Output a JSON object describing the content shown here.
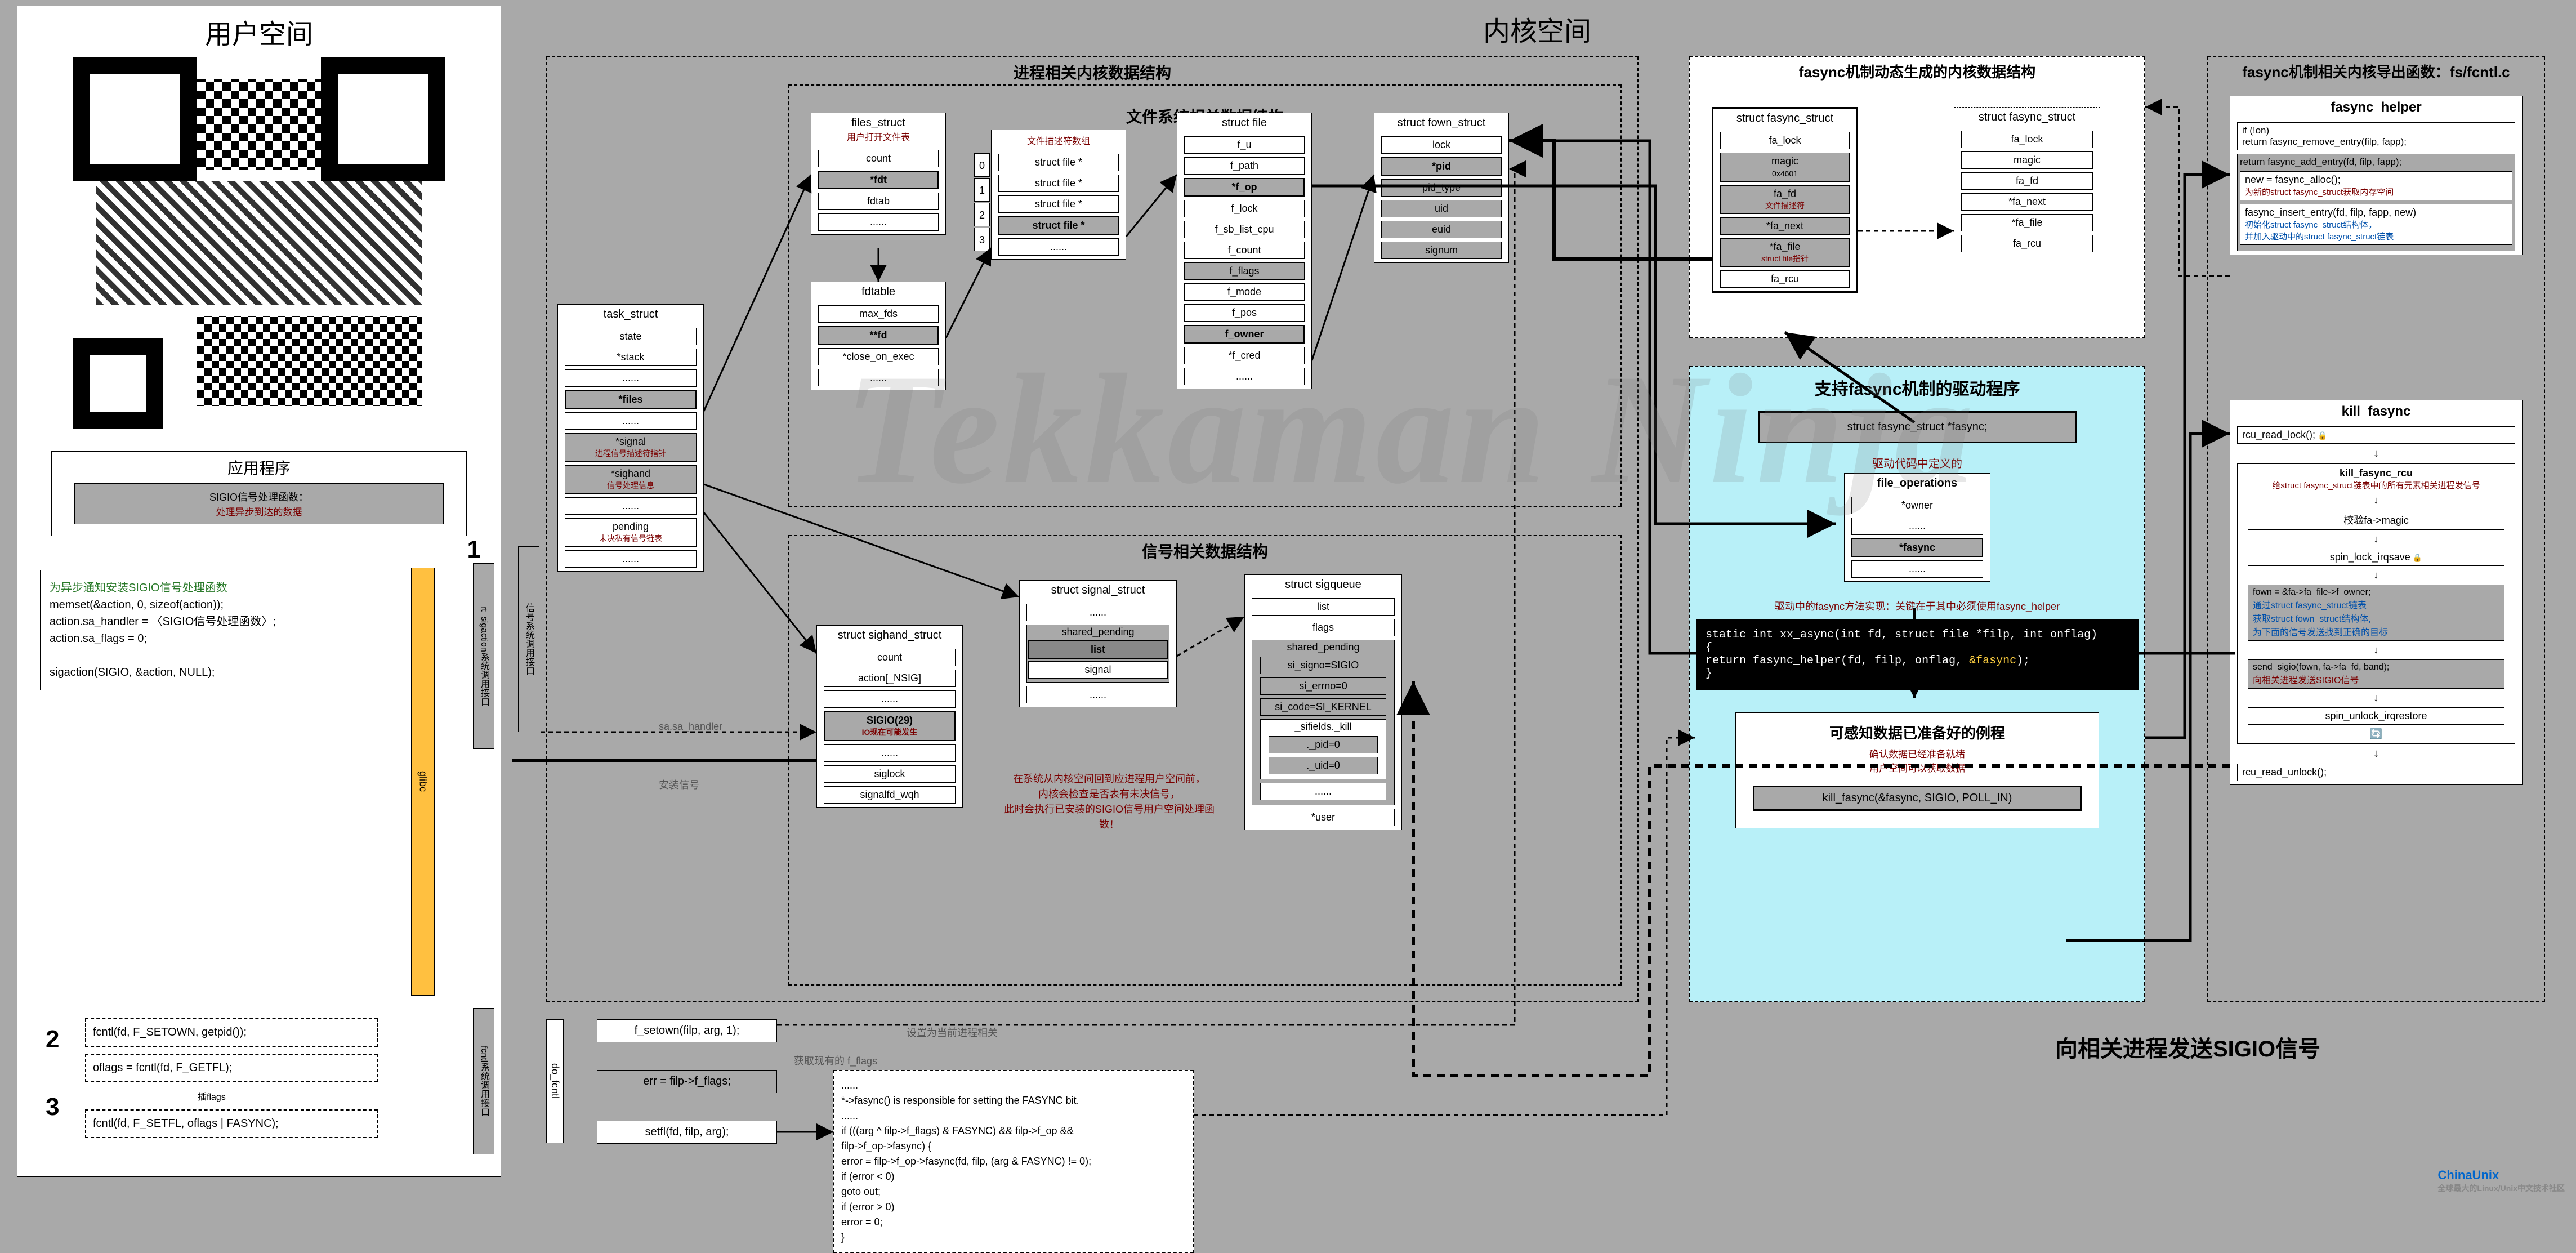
{
  "titles": {
    "user_space": "用户空间",
    "kernel_space": "内核空间",
    "app_box": "应用程序",
    "watermark": "Tekkaman Ninja"
  },
  "sigio_handler": {
    "line1": "SIGIO信号处理函数：",
    "line2": "处理异步到达的数据"
  },
  "user_code": {
    "c1": "为异步通知安装SIGIO信号处理函数",
    "l1": "memset(&action, 0, sizeof(action));",
    "l2": "action.sa_handler = 〈SIGIO信号处理函数〉;",
    "l3": "action.sa_flags = 0;",
    "l4": "sigaction(SIGIO, &action, NULL);"
  },
  "step2": {
    "code": "fcntl(fd, F_SETOWN, getpid());"
  },
  "step3": {
    "code1": "oflags = fcntl(fd, F_GETFL);",
    "inter": "插flags",
    "code2": "fcntl(fd, F_SETFL, oflags | FASYNC);"
  },
  "task_struct": {
    "title": "task_struct",
    "fields": [
      "state",
      "*stack",
      "......",
      "*files",
      "......",
      "*signal",
      "*sighand",
      "......",
      "pending",
      "......"
    ],
    "signal_sub": "进程信号描述符指针",
    "sighand_sub": "信号处理信息",
    "pending_sub": "未决私有信号链表"
  },
  "proc_group": {
    "title": "进程相关内核数据结构"
  },
  "file_group": {
    "title": "文件系统相关数据结构",
    "files_struct": "files_struct",
    "files_struct_sub": "用户打开文件表",
    "fs_fields": [
      "count",
      "*fdt",
      "fdtab",
      "......"
    ],
    "fdtable": "fdtable",
    "fdtable_sub": "文件描述符数组",
    "fdt_fields": [
      "max_fds",
      "**fd",
      "*close_on_exec",
      "......"
    ],
    "arr": [
      "struct file *",
      "struct file *",
      "struct file *",
      "struct file *",
      "......"
    ],
    "struct_file": "struct file",
    "file_fields": [
      "f_u",
      "f_path",
      "*f_op",
      "f_lock",
      "f_sb_list_cpu",
      "f_count",
      "f_flags",
      "f_mode",
      "f_pos",
      "f_owner",
      "*f_cred",
      "......"
    ],
    "fown_struct": "struct fown_struct",
    "fown_fields": [
      "lock",
      "*pid",
      "pid_type",
      "uid",
      "euid",
      "signum"
    ]
  },
  "signal_group": {
    "title": "信号相关数据结构",
    "sighand": "struct sighand_struct",
    "sighand_fields": [
      "count",
      "action[_NSIG]",
      "......",
      "siglock",
      "signalfd_wqh"
    ],
    "action_hl": "SIGIO(29)",
    "action_hl_sub": "IO现在可能发生",
    "signal_struct": "struct signal_struct",
    "ss_fields": [
      "......",
      "shared_pending",
      "......",
      "signal",
      "......"
    ],
    "ss_list": "list",
    "sigqueue": "struct sigqueue",
    "sq_fields": [
      "list",
      "flags",
      "shared_pending",
      "si_signo=SIGIO",
      "si_errno=0",
      "si_code=SI_KERNEL",
      "_sifields._kill",
      "._pid=0",
      "._uid=0",
      "......",
      "*user"
    ],
    "note1": "在系统从内核空间回到应进程用户空间前，",
    "note2": "内核会检查是否表有未决信号，",
    "note3": "此时会执行已安装的SIGIO信号用户空间处理函数！"
  },
  "fasync_group": {
    "title": "fasync机制动态生成的内核数据结构",
    "fasync_struct": "struct fasync_struct",
    "fa_fields": [
      "fa_lock",
      "magic",
      "fa_fd",
      "*fa_next",
      "*fa_file",
      "fa_rcu"
    ],
    "fa_magic": "0x4601",
    "fa_fd_sub": "文件描述符",
    "fa_file_sub": "struct file指针"
  },
  "driver_panel": {
    "title": "支持fasync机制的驱动程序",
    "ptr_decl": "struct fasync_struct *fasync;",
    "fops_sub": "驱动代码中定义的",
    "fops": "file_operations",
    "fops_fields": [
      "*owner",
      "......",
      "*fasync",
      "......"
    ],
    "method_note": "驱动中的fasync方法实现：关键在于其中必须使用fasync_helper",
    "code_l1": "static int xx_async(int fd, struct file *filp, int onflag)",
    "code_l2": "{",
    "code_l3": "    return fasync_helper(fd, filp, onflag, &fasync);",
    "code_l4": "}",
    "ready": "可感知数据已准备好的例程",
    "ready_sub1": "确认数据已经准备就绪",
    "ready_sub2": "用户空间可以获取数据",
    "kill_call": "kill_fasync(&fasync, SIGIO, POLL_IN)"
  },
  "export_group": {
    "title": "fasync机制相关内核导出函数：fs/fcntl.c",
    "fasync_helper": "fasync_helper",
    "fh_l1": "if (!on)",
    "fh_l2": "  return fasync_remove_entry(filp, fapp);",
    "fh_l3": "return fasync_add_entry(fd, filp, fapp);",
    "fh_alloc": "new = fasync_alloc();",
    "fh_alloc_sub": "为新的struct fasync_struct获取内存空间",
    "fh_insert": "fasync_insert_entry(fd, filp, fapp, new)",
    "fh_insert_sub1": "初始化struct fasync_struct结构体，",
    "fh_insert_sub2": "并加入驱动中的struct fasync_struct链表",
    "kill_fasync": "kill_fasync",
    "kf_l1": "rcu_read_lock();",
    "kf_rcu": "kill_fasync_rcu",
    "kf_rcu_sub": "给struct fasync_struct链表中的所有元素相关进程发信号",
    "kf_l2": "校验fa->magic",
    "kf_l3": "spin_lock_irqsave",
    "kf_l4a": "fown = &fa->fa_file->f_owner;",
    "kf_l4b": "通过struct fasync_struct链表",
    "kf_l4c": "获取struct fown_struct结构体,",
    "kf_l4d": "为下面的信号发送找到正确的目标",
    "kf_l5": "send_sigio(fown, fa->fa_fd, band);",
    "kf_l5_sub": "向相关进程发送SIGIO信号",
    "kf_l6": "spin_unlock_irqrestore",
    "kf_l7": "rcu_read_unlock();",
    "big_arrow_label": "向相关进程发送SIGIO信号"
  },
  "bottom": {
    "f_setown": "f_setown(filp, arg, 1);",
    "f_setown_note": "设置为当前进程相关",
    "get_flags": "err = filp->f_flags;",
    "get_flags_note": "获取现有的 f_flags",
    "setfl": "setfl(fd, filp, arg);",
    "do_fcntl": "do_fcntl",
    "note_title": "......",
    "n1": "*->fasync() is responsible for setting the FASYNC bit.",
    "n2": "......",
    "n3": "if (((arg ^ filp->f_flags) & FASYNC) && filp->f_op &&",
    "n4": "        filp->f_op->fasync) {",
    "n5": "    error = filp->f_op->fasync(fd, filp, (arg & FASYNC) != 0);",
    "n6": "    if (error < 0)",
    "n7": "        goto out;",
    "n8": "    if (error > 0)",
    "n9": "        error = 0;",
    "n10": "}"
  },
  "bars": {
    "glibc": "glibc",
    "sigaction": "rt_sigaction系统调用接口",
    "sigaction2": "信号系统调用接口",
    "fcntl": "fcntl系统调用接口"
  },
  "captions": {
    "install": "安装信号",
    "sa_handler": "sa.sa_handler"
  },
  "logo": {
    "main": "ChinaUnix",
    "sub": "全球最大的Linux/Unix中文技术社区"
  }
}
